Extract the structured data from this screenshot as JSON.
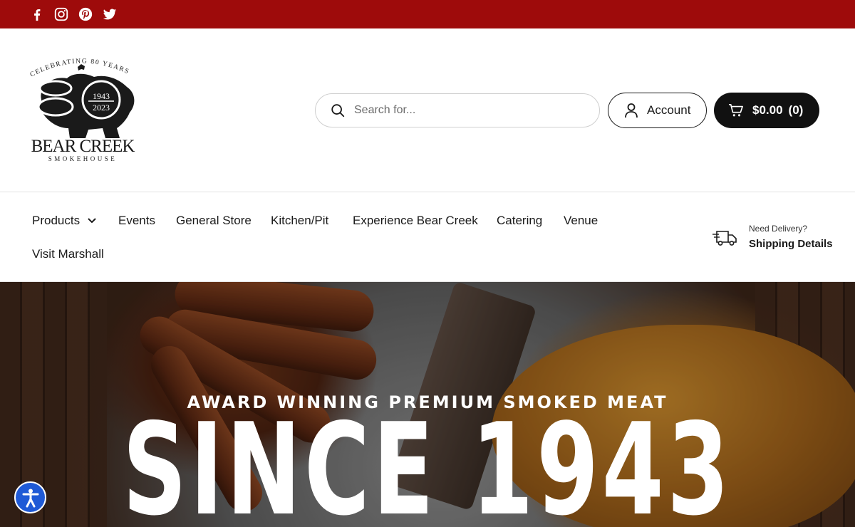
{
  "colors": {
    "topbar": "#9e0b0b",
    "cart": "#111111",
    "a11y": "#1f5ad6"
  },
  "social": [
    {
      "icon": "facebook-icon"
    },
    {
      "icon": "instagram-icon"
    },
    {
      "icon": "pinterest-icon"
    },
    {
      "icon": "twitter-icon"
    }
  ],
  "logo": {
    "arc_text": "CELEBRATING 80 YEARS",
    "year_start": "1943",
    "year_end": "2023",
    "name": "BEAR CREEK",
    "sub": "SMOKEHOUSE"
  },
  "search": {
    "placeholder": "Search for..."
  },
  "account": {
    "label": "Account"
  },
  "cart": {
    "total": "$0.00",
    "count": "(0)"
  },
  "nav": {
    "items": [
      "Products",
      "Events",
      "General Store",
      "Kitchen/Pit",
      "Experience Bear Creek",
      "Catering",
      "Venue",
      "Visit Marshall"
    ]
  },
  "delivery": {
    "small": "Need Delivery?",
    "big": "Shipping Details"
  },
  "hero": {
    "subtitle": "AWARD WINNING PREMIUM SMOKED MEAT",
    "title": "SINCE 1943"
  }
}
